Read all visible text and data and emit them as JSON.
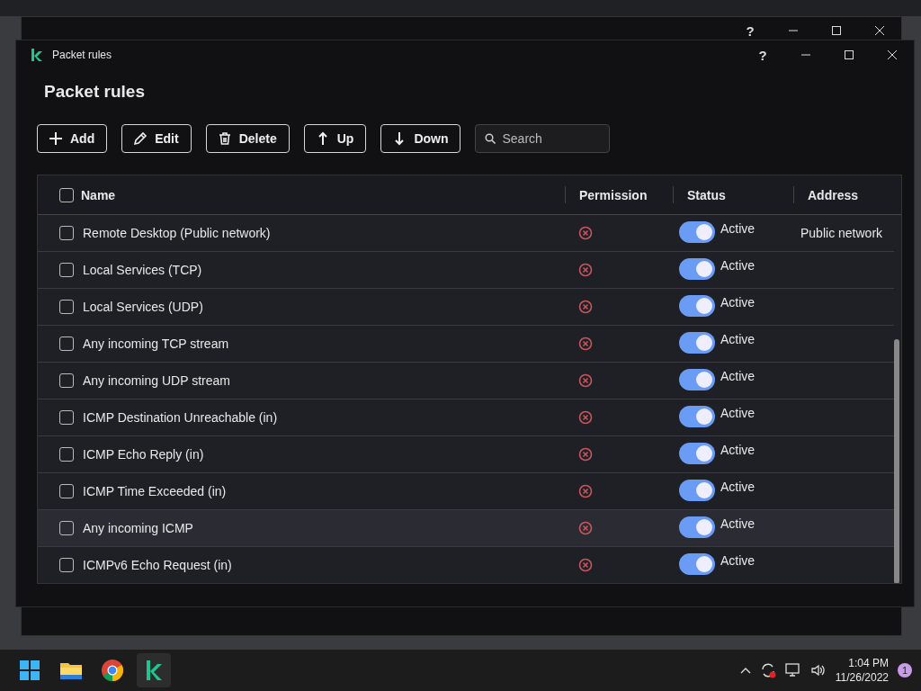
{
  "back_window": {
    "help": "?"
  },
  "window": {
    "title": "Packet rules",
    "help": "?",
    "heading": "Packet rules"
  },
  "toolbar": [
    {
      "kind": "add",
      "label": "Add"
    },
    {
      "kind": "edit",
      "label": "Edit"
    },
    {
      "kind": "delete",
      "label": "Delete"
    },
    {
      "kind": "up",
      "label": "Up"
    },
    {
      "kind": "down",
      "label": "Down"
    }
  ],
  "search": {
    "placeholder": "Search"
  },
  "table": {
    "select_all_checked": false,
    "columns": [
      "Name",
      "Permission",
      "Status",
      "Address"
    ],
    "rows": [
      {
        "name": "Remote Desktop (Public network)",
        "checked": false,
        "permission": {
          "kind": "block"
        },
        "on": true,
        "status": "Active",
        "address": "Public network",
        "hovered": false
      },
      {
        "name": "Local Services (TCP)",
        "checked": false,
        "permission": {
          "kind": "block"
        },
        "on": true,
        "status": "Active",
        "hovered": false
      },
      {
        "name": "Local Services (UDP)",
        "checked": false,
        "permission": {
          "kind": "block"
        },
        "on": true,
        "status": "Active",
        "hovered": false
      },
      {
        "name": "Any incoming TCP stream",
        "checked": false,
        "permission": {
          "kind": "block"
        },
        "on": true,
        "status": "Active",
        "hovered": false
      },
      {
        "name": "Any incoming UDP stream",
        "checked": false,
        "permission": {
          "kind": "block"
        },
        "on": true,
        "status": "Active",
        "hovered": false
      },
      {
        "name": "ICMP Destination Unreachable (in)",
        "checked": false,
        "permission": {
          "kind": "block"
        },
        "on": true,
        "status": "Active",
        "hovered": false
      },
      {
        "name": "ICMP Echo Reply (in)",
        "checked": false,
        "permission": {
          "kind": "block"
        },
        "on": true,
        "status": "Active",
        "hovered": false
      },
      {
        "name": "ICMP Time Exceeded (in)",
        "checked": false,
        "permission": {
          "kind": "block"
        },
        "on": true,
        "status": "Active",
        "hovered": false
      },
      {
        "name": "Any incoming ICMP",
        "checked": false,
        "permission": {
          "kind": "block"
        },
        "on": true,
        "status": "Active",
        "hovered": true
      },
      {
        "name": "ICMPv6 Echo Request (in)",
        "checked": false,
        "permission": {
          "kind": "block"
        },
        "on": true,
        "status": "Active",
        "hovered": false
      }
    ]
  },
  "taskbar": {
    "apps": [
      {
        "kind": "start",
        "active": false
      },
      {
        "kind": "folder",
        "active": false
      },
      {
        "kind": "chrome",
        "active": false
      },
      {
        "kind": "kaspersky",
        "active": true
      }
    ],
    "time": "1:04 PM",
    "date": "11/26/2022",
    "notifications": "1"
  }
}
